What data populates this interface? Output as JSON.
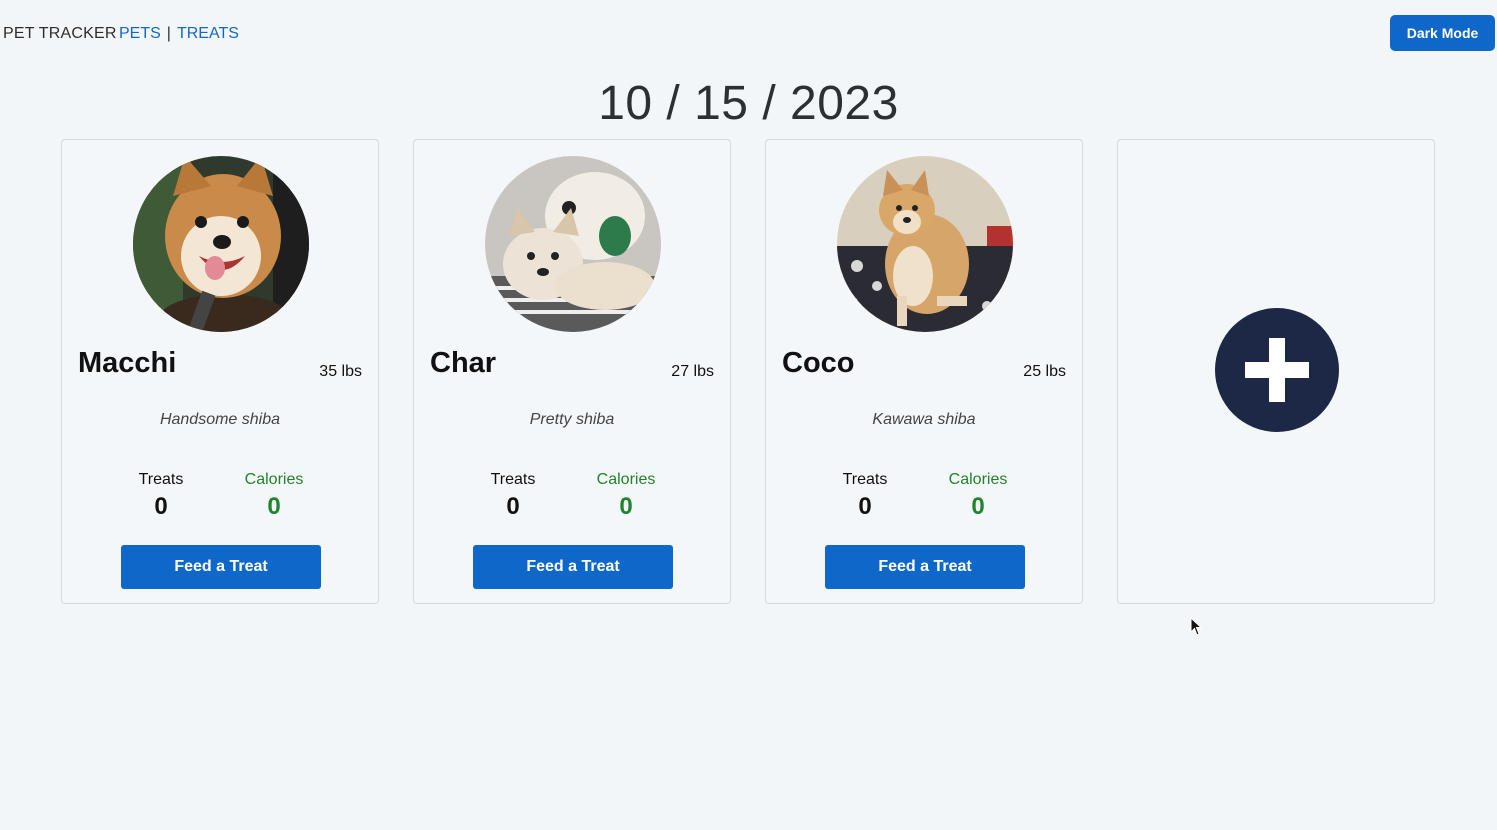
{
  "header": {
    "brand": "PET TRACKER",
    "nav": [
      {
        "label": "PETS"
      },
      {
        "label": "TREATS"
      }
    ],
    "separator": "|",
    "dark_mode_label": "Dark Mode"
  },
  "date": "10 / 15 / 2023",
  "pets": [
    {
      "name": "Macchi",
      "weight": "35 lbs",
      "description": "Handsome shiba",
      "treats_label": "Treats",
      "treats_value": "0",
      "calories_label": "Calories",
      "calories_value": "0",
      "button_label": "Feed a Treat"
    },
    {
      "name": "Char",
      "weight": "27 lbs",
      "description": "Pretty shiba",
      "treats_label": "Treats",
      "treats_value": "0",
      "calories_label": "Calories",
      "calories_value": "0",
      "button_label": "Feed a Treat"
    },
    {
      "name": "Coco",
      "weight": "25 lbs",
      "description": "Kawawa shiba",
      "treats_label": "Treats",
      "treats_value": "0",
      "calories_label": "Calories",
      "calories_value": "0",
      "button_label": "Feed a Treat"
    }
  ],
  "add_card": {
    "icon": "plus-icon"
  },
  "colors": {
    "primary": "#0f67c9",
    "calories": "#22832a",
    "add_circle": "#1c2845",
    "background": "#f3f6f9"
  }
}
